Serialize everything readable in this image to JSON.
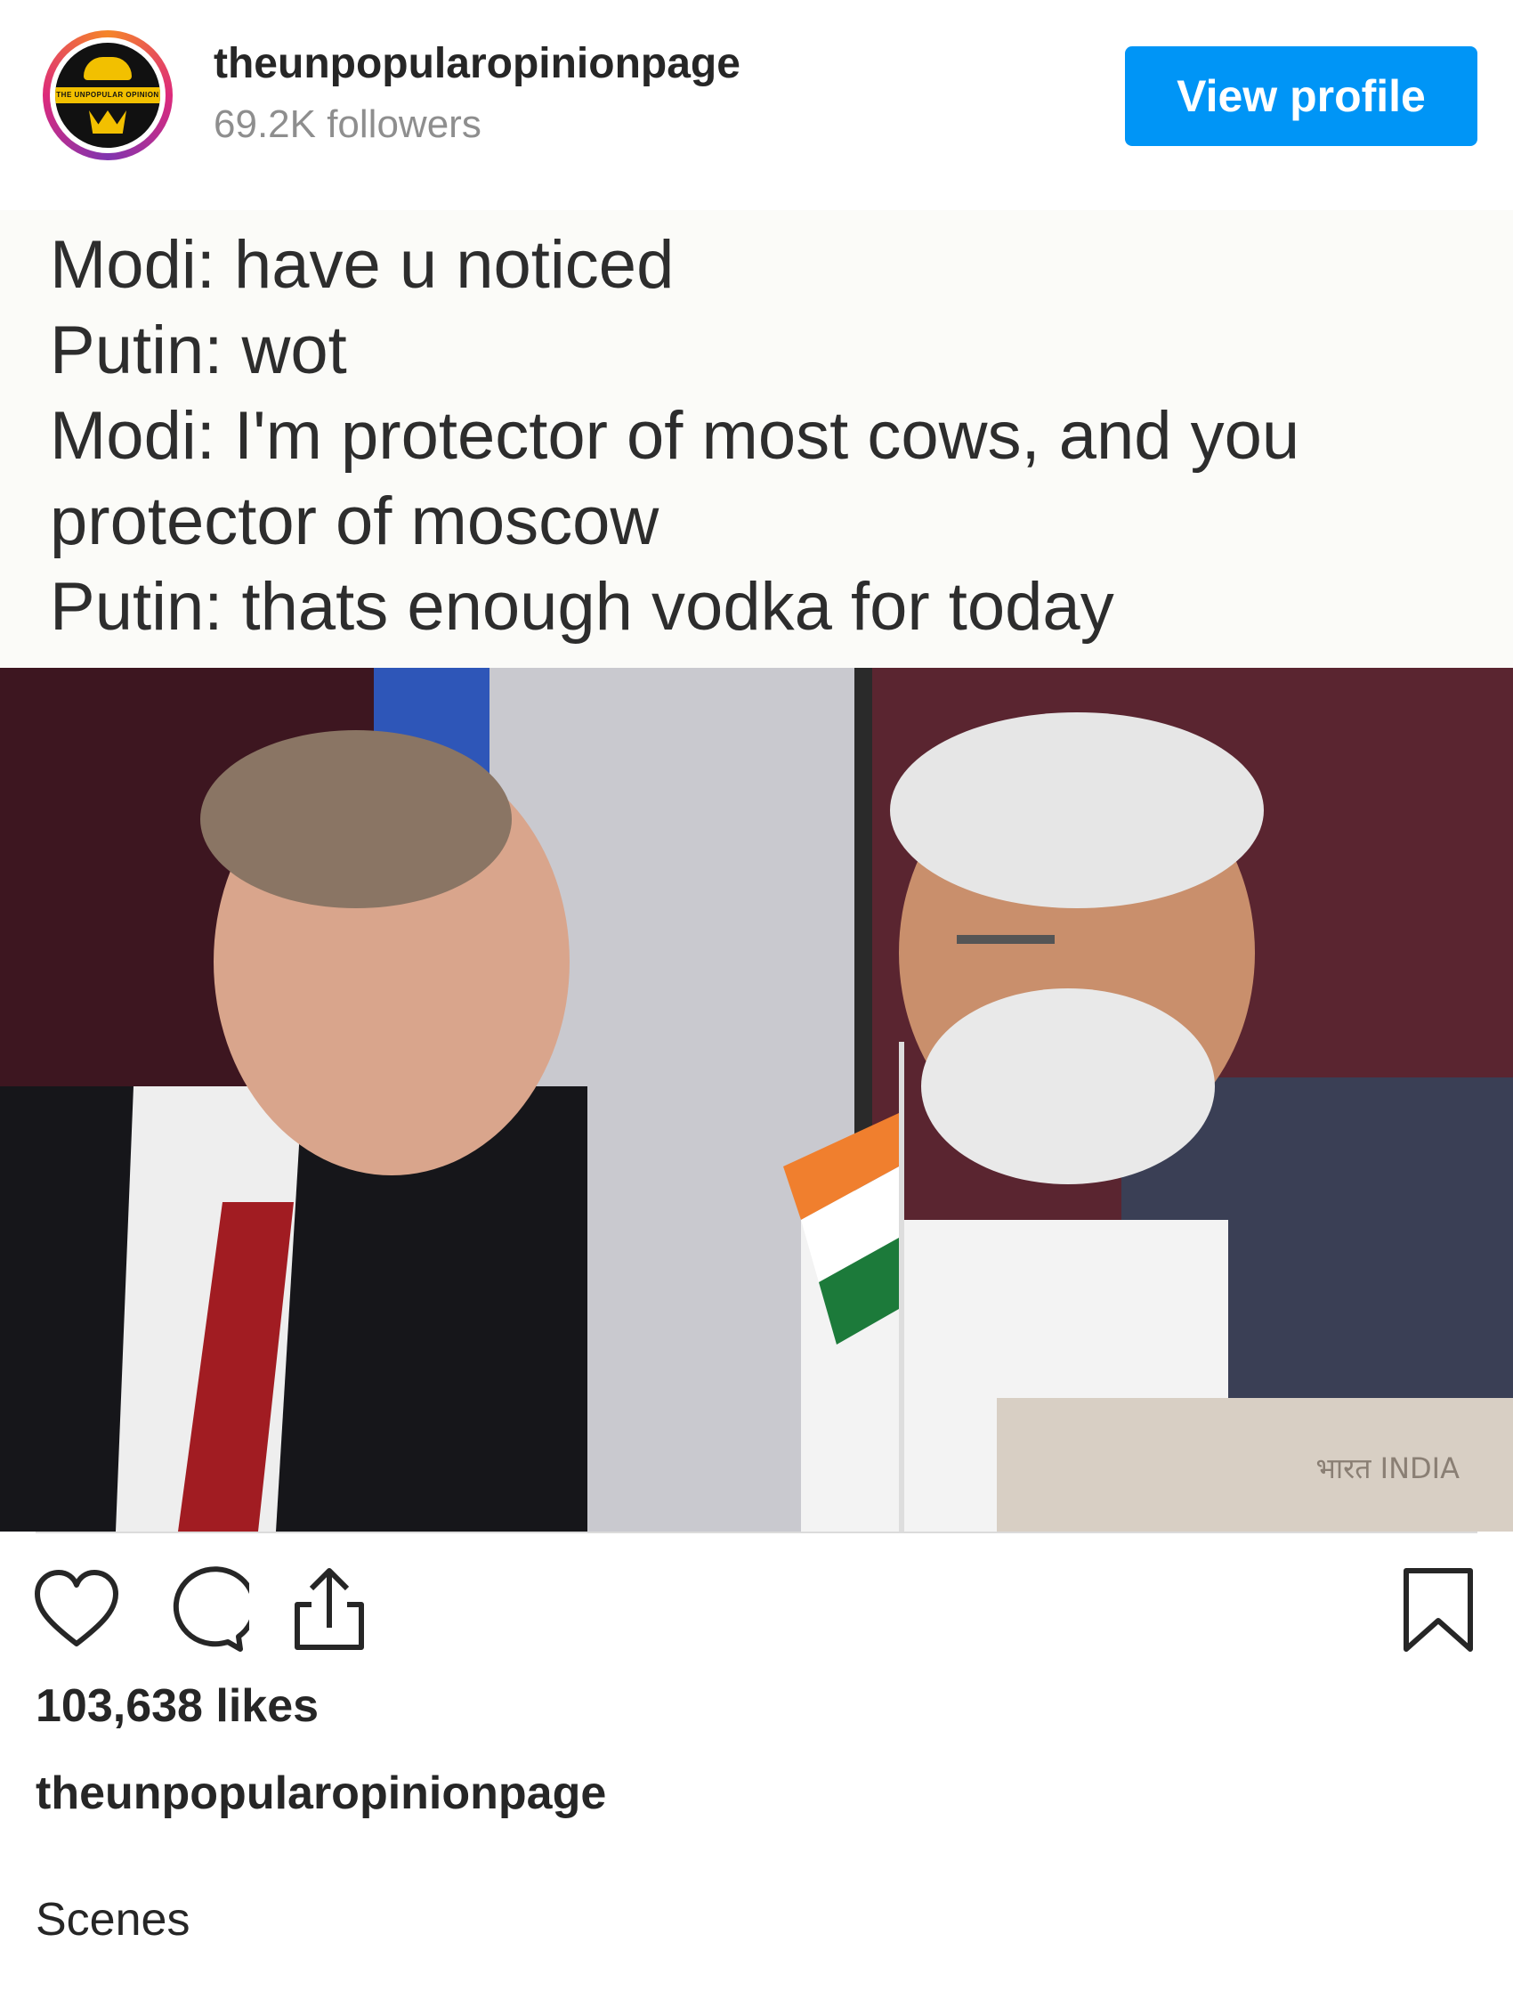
{
  "header": {
    "username": "theunpopularopinionpage",
    "followers": "69.2K followers",
    "view_profile_label": "View profile",
    "avatar_logo_text": "THE UNPOPULAR OPINION"
  },
  "post": {
    "text_lines": [
      "Modi: have u noticed",
      "Putin: wot",
      "Modi: I'm protector of most cows, and you",
      "protector of moscow",
      "Putin: thats enough vodka for today"
    ],
    "photo_plaque_text": "भारत INDIA"
  },
  "actions": {
    "like_icon": "heart-icon",
    "comment_icon": "comment-icon",
    "share_icon": "share-icon",
    "save_icon": "bookmark-icon"
  },
  "likes": "103,638 likes",
  "caption": {
    "username": "theunpopularopinionpage",
    "text": "Scenes"
  },
  "colors": {
    "accent": "#0095f6",
    "text": "#262626",
    "muted": "#8e8e8e"
  }
}
